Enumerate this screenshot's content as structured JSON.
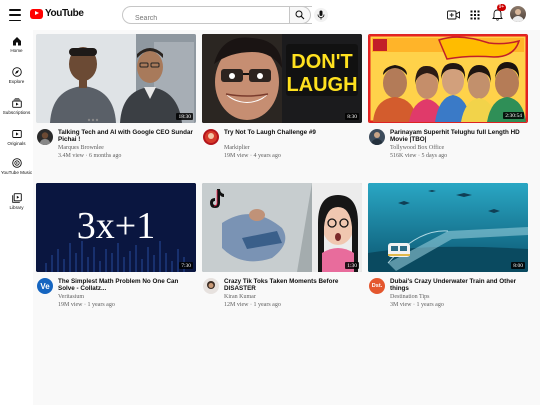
{
  "header": {
    "logo_text": "YouTube",
    "search_placeholder": "Search",
    "notification_count": "9+"
  },
  "sidebar": {
    "items": [
      {
        "label": "Home",
        "icon": "home-icon"
      },
      {
        "label": "Explore",
        "icon": "compass-icon"
      },
      {
        "label": "Subscriptions",
        "icon": "subscriptions-icon"
      },
      {
        "label": "Originals",
        "icon": "originals-icon"
      },
      {
        "label": "YouTube Music",
        "icon": "music-icon"
      },
      {
        "label": "Library",
        "icon": "library-icon"
      }
    ]
  },
  "videos": [
    {
      "title": "Talking Tech and AI with Google CEO Sundar Pichai !",
      "channel": "Marques Brownlee",
      "stats": "3.4M view · 6 months ago",
      "duration": "18:30"
    },
    {
      "title": "Try Not To Laugh Challenge #9",
      "channel": "Markiplier",
      "stats": "19M view · 4 years ago",
      "duration": "8:30",
      "thumb_text": [
        "DON'T",
        "LAUGH"
      ]
    },
    {
      "title": "Parinayam Superhit Telughu full Length HD Movie |TBO|",
      "channel": "Tollywood Box Office",
      "stats": "516K view · 5 days ago",
      "duration": "2:30:54"
    },
    {
      "title": "The Simplest Math Problem No One Can Solve - Collatz...",
      "channel": "Veritasium",
      "stats": "19M view · 1 years ago",
      "duration": "7:30",
      "thumb_text": [
        "3x+1"
      ],
      "avatar_text": "Ve"
    },
    {
      "title": "Crazy Tik Toks Taken Moments Before DISASTER",
      "channel": "Kiran Kumar",
      "stats": "12M view · 1 years ago",
      "duration": "1:30"
    },
    {
      "title": "Dubai's Crazy Underwater Train and Other things",
      "channel": "Destination Tips",
      "stats": "3M view · 1 years ago",
      "duration": "8:00",
      "avatar_text": "Dst."
    }
  ]
}
